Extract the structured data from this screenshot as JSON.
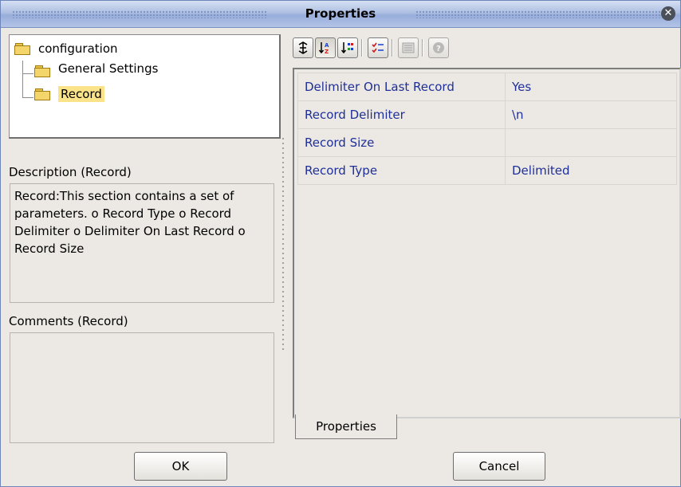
{
  "window": {
    "title": "Properties"
  },
  "tree": {
    "root": "configuration",
    "children": [
      "General Settings",
      "Record"
    ],
    "selected": "Record"
  },
  "toolbar": {
    "icons": [
      "expand-icon",
      "sort-alphabetic-icon",
      "sort-category-icon",
      "checklist-icon",
      "list-view-icon",
      "help-icon"
    ]
  },
  "description": {
    "label": "Description (Record)",
    "text": "Record:This section contains a set of parameters.   o Record Type   o Record Delimiter   o Delimiter On Last Record   o Record Size"
  },
  "comments": {
    "label": "Comments (Record)",
    "text": ""
  },
  "properties": {
    "rows": [
      {
        "name": "Delimiter On Last Record",
        "value": "Yes"
      },
      {
        "name": "Record Delimiter",
        "value": "\\n"
      },
      {
        "name": "Record Size",
        "value": ""
      },
      {
        "name": "Record Type",
        "value": "Delimited"
      }
    ]
  },
  "tabs": {
    "properties": "Properties"
  },
  "buttons": {
    "ok": "OK",
    "cancel": "Cancel"
  },
  "colors": {
    "value_text": "#1f2f9a",
    "selection": "#fbe38a",
    "title_gradient": "#98addb"
  }
}
